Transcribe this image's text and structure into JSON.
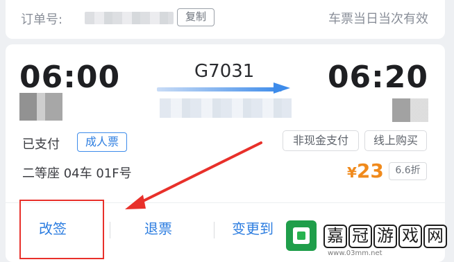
{
  "header": {
    "order_label": "订单号:",
    "copy_label": "复制",
    "valid_note": "车票当日当次有效"
  },
  "ticket": {
    "departure_time": "06:00",
    "arrival_time": "06:20",
    "train_no": "G7031",
    "pay_status": "已支付",
    "ticket_type": "成人票",
    "tags": [
      "非现金支付",
      "线上购买"
    ],
    "seat_info": "二等座 04车 01F号",
    "price_symbol": "¥",
    "price_value": "23",
    "discount": "6.6折"
  },
  "actions": {
    "change": "改签",
    "refund": "退票",
    "change_to": "变更到"
  },
  "watermark": {
    "chars": [
      "嘉",
      "冠",
      "游",
      "戏",
      "网"
    ],
    "site": "www.03mm.net"
  },
  "colors": {
    "accent": "#2c7de0",
    "price": "#f08a1c",
    "annotation": "#e8302a"
  }
}
